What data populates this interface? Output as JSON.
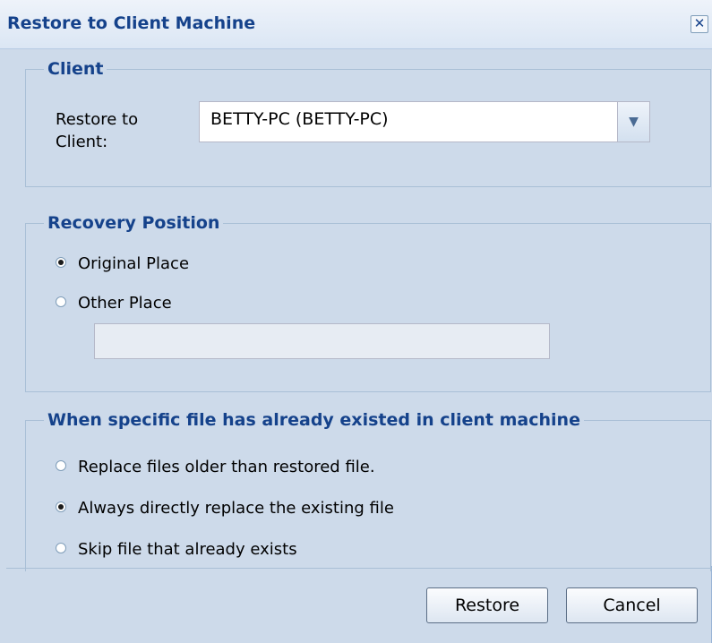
{
  "dialog": {
    "title": "Restore to Client Machine",
    "close_symbol": "✕"
  },
  "client_section": {
    "legend": "Client",
    "restore_to_label_line1": "Restore to",
    "restore_to_label_line2": "Client:",
    "selected_client": "BETTY-PC (BETTY-PC)",
    "dropdown_icon": "chevron-down-icon"
  },
  "recovery_section": {
    "legend": "Recovery Position",
    "options": [
      {
        "label": "Original Place",
        "checked": true
      },
      {
        "label": "Other Place",
        "checked": false
      }
    ],
    "other_place_value": ""
  },
  "exists_section": {
    "legend": "When specific file has already existed in client machine",
    "options": [
      {
        "label": "Replace files older than restored file.",
        "checked": false
      },
      {
        "label": "Always directly replace the existing file",
        "checked": true
      },
      {
        "label": "Skip file that already exists",
        "checked": false
      }
    ]
  },
  "buttons": {
    "restore": "Restore",
    "cancel": "Cancel"
  },
  "colors": {
    "dialog_bg": "#cddaea",
    "title_text": "#15428b"
  }
}
